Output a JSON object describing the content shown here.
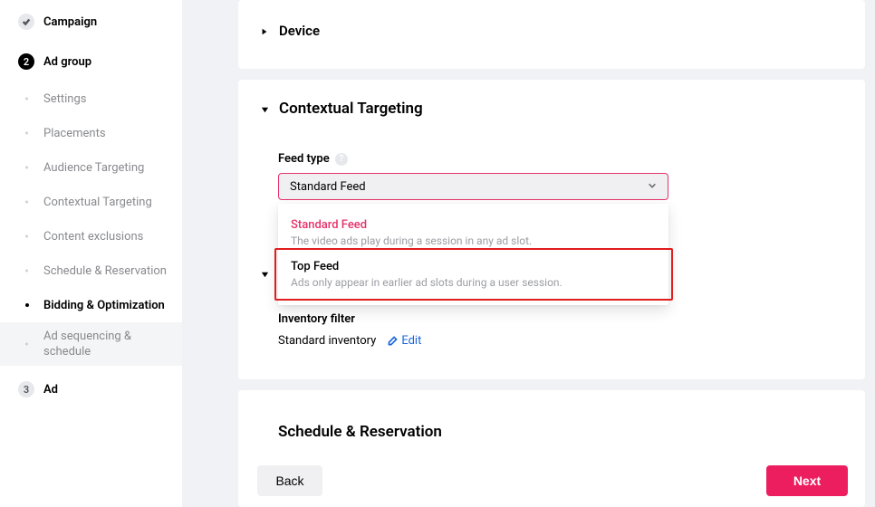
{
  "sidebar": {
    "steps": {
      "campaign": {
        "num": "✓",
        "label": "Campaign"
      },
      "adgroup": {
        "num": "2",
        "label": "Ad group"
      },
      "ad": {
        "num": "3",
        "label": "Ad"
      }
    },
    "adgroup_items": [
      "Settings",
      "Placements",
      "Audience Targeting",
      "Contextual Targeting",
      "Content exclusions",
      "Schedule & Reservation",
      "Bidding & Optimization",
      "Ad sequencing & schedule"
    ]
  },
  "device_card": {
    "title": "Device"
  },
  "context_card": {
    "title": "Contextual Targeting",
    "feed_type_label": "Feed type",
    "selected_feed": "Standard Feed",
    "options": [
      {
        "name": "Standard Feed",
        "desc": "The video ads play during a session in any ad slot."
      },
      {
        "name": "Top Feed",
        "desc": "Ads only appear in earlier ad slots during a user session."
      }
    ],
    "inventory_label": "Inventory filter",
    "inventory_value": "Standard inventory",
    "edit_label": "Edit"
  },
  "schedule_card": {
    "title": "Schedule & Reservation",
    "back": "Back",
    "next": "Next"
  }
}
